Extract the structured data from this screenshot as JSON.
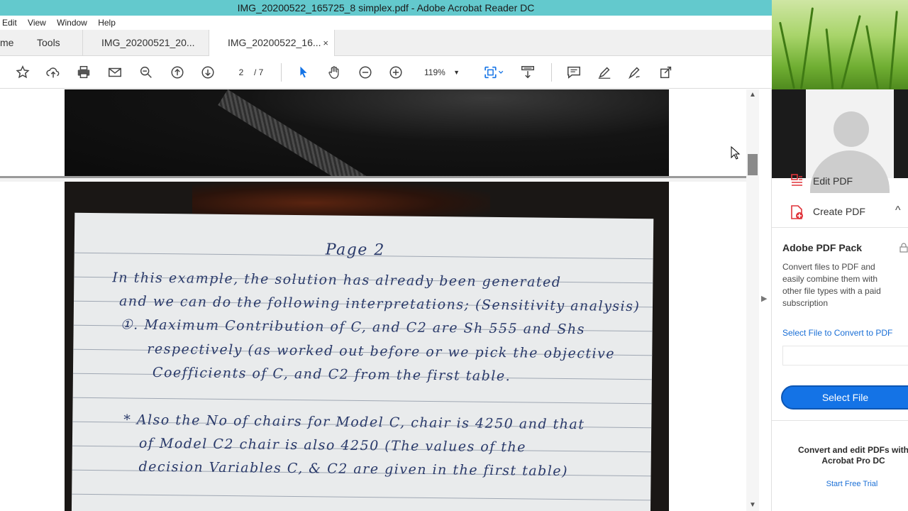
{
  "window": {
    "title": "IMG_20200522_165725_8 simplex.pdf - Adobe Acrobat Reader DC"
  },
  "menu": {
    "items": [
      "Edit",
      "View",
      "Window",
      "Help"
    ]
  },
  "tabs": {
    "home": "me",
    "tools": "Tools",
    "doc1": "IMG_20200521_20...",
    "doc2": "IMG_20200522_16...",
    "close_glyph": "×"
  },
  "toolbar": {
    "page_current": "2",
    "page_total": "/ 7",
    "zoom": "119%",
    "zoom_caret": "▼",
    "icons": [
      "star-icon",
      "upload-icon",
      "print-icon",
      "mail-icon",
      "zoom-search-icon",
      "page-up-icon",
      "page-down-icon",
      "select-cursor-icon",
      "hand-icon",
      "zoom-out-icon",
      "zoom-in-icon",
      "fit-page-icon",
      "scroll-mode-icon",
      "comment-icon",
      "highlight-pen-icon",
      "sign-icon",
      "share-icon"
    ]
  },
  "document": {
    "handwriting": [
      "Page 2",
      "In this example, the solution has already been generated",
      "and we can do the following interpretations; (Sensitivity analysis)",
      "①. Maximum Contribution of C, and C2 are Sh 555 and Shs",
      "respectively (as worked out before or we pick the objective",
      "Coefficients of C, and C2 from the first table.",
      "* Also the No of chairs for Model C, chair is 4250 and that",
      "of Model C2 chair is also 4250 (The values of the",
      "decision Variables C, & C2 are given in the first table)"
    ]
  },
  "scrollbar": {
    "up": "▲",
    "down": "▼"
  },
  "gutter": {
    "chevron": "▶"
  },
  "right_panel": {
    "edit_pdf": "Edit PDF",
    "create_pdf": "Create PDF",
    "collapse_glyph": "^",
    "pack_title": "Adobe PDF Pack",
    "pack_desc": "Convert files to PDF and easily combine them with other file types with a paid subscription",
    "convert_link": "Select File to Convert to PDF",
    "select_button": "Select File",
    "promo": "Convert and edit PDFs with Acrobat Pro DC",
    "trial_link": "Start Free Trial",
    "accent": "#1473e6",
    "brand_red": "#e0333a"
  }
}
